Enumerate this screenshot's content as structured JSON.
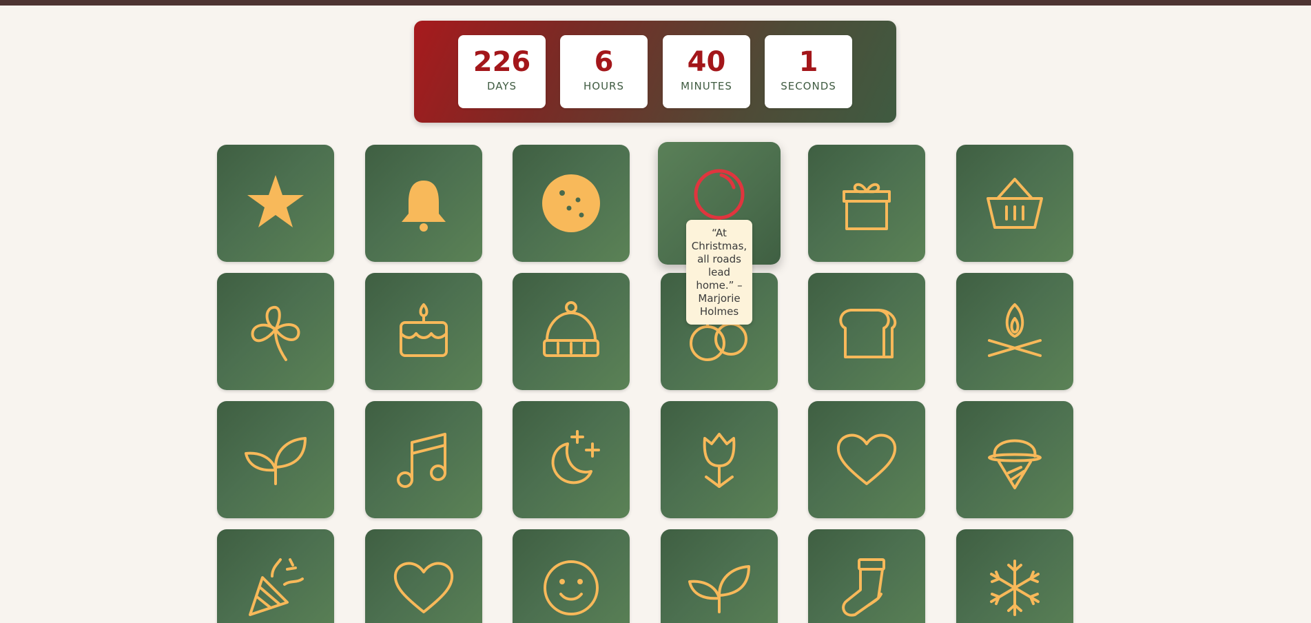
{
  "countdown": {
    "days": {
      "value": "226",
      "label": "DAYS"
    },
    "hours": {
      "value": "6",
      "label": "HOURS"
    },
    "minutes": {
      "value": "40",
      "label": "MINUTES"
    },
    "seconds": {
      "value": "1",
      "label": "SECONDS"
    }
  },
  "tooltip": {
    "text": "“At Christmas, all roads lead home.” – Marjorie Holmes"
  },
  "colors": {
    "tile": "#4c7050",
    "icon": "#f8b95a",
    "accent": "#a3161a",
    "ornament": "#e0353e",
    "background": "#f8f4ef",
    "tooltip_bg": "#fdf3da"
  },
  "tiles": [
    {
      "icon": "star-icon"
    },
    {
      "icon": "bell-icon"
    },
    {
      "icon": "cookie-icon"
    },
    {
      "icon": "ornament-icon"
    },
    {
      "icon": "gift-icon"
    },
    {
      "icon": "basket-icon"
    },
    {
      "icon": "clover-icon"
    },
    {
      "icon": "cake-icon"
    },
    {
      "icon": "beanie-hat-icon"
    },
    {
      "icon": "ornaments-icon"
    },
    {
      "icon": "bread-icon"
    },
    {
      "icon": "campfire-icon"
    },
    {
      "icon": "leaves-icon"
    },
    {
      "icon": "music-note-icon"
    },
    {
      "icon": "moon-stars-icon"
    },
    {
      "icon": "tulip-icon"
    },
    {
      "icon": "heart-icon"
    },
    {
      "icon": "ice-cream-icon"
    },
    {
      "icon": "party-popper-icon"
    },
    {
      "icon": "heart-icon"
    },
    {
      "icon": "smiley-icon"
    },
    {
      "icon": "leaves-icon"
    },
    {
      "icon": "sock-icon"
    },
    {
      "icon": "snowflake-icon"
    }
  ]
}
